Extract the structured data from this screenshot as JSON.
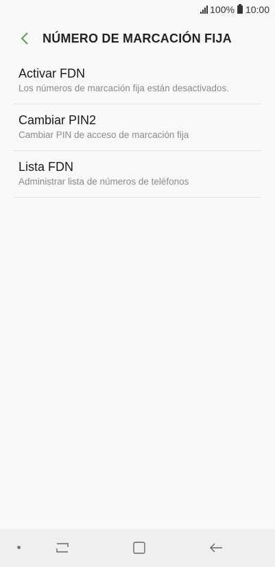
{
  "status_bar": {
    "battery_text": "100%",
    "time": "10:00"
  },
  "header": {
    "title": "NÚMERO DE MARCACIÓN FIJA",
    "accent_color": "#5aa051"
  },
  "items": [
    {
      "title": "Activar FDN",
      "subtitle": "Los números de marcación fija están desactivados."
    },
    {
      "title": "Cambiar PIN2",
      "subtitle": "Cambiar PIN de acceso de marcación fija"
    },
    {
      "title": "Lista FDN",
      "subtitle": "Administrar lista de números de teléfonos"
    }
  ],
  "navbar": {
    "icons": [
      "dot-icon",
      "recent-apps-icon",
      "home-icon",
      "back-icon"
    ]
  }
}
